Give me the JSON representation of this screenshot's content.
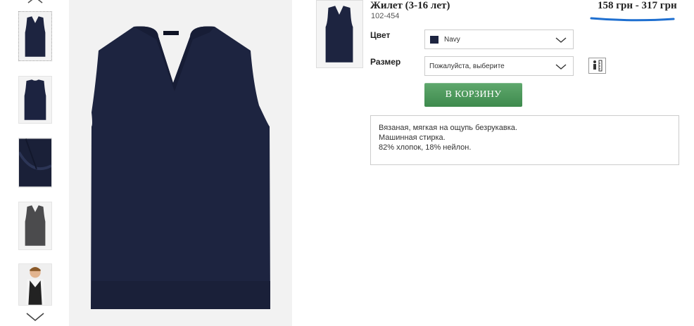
{
  "product": {
    "title": "Жилет (3-16 лет)",
    "code": "102-454",
    "price": "158 грн - 317 грн"
  },
  "options": {
    "color_label": "Цвет",
    "color_value": "Navy",
    "color_swatch": "#1d2440",
    "size_label": "Размер",
    "size_placeholder": "Пожалуйста, выберите"
  },
  "actions": {
    "add_to_cart": "В КОРЗИНУ",
    "cart_color": "#4a9a5a"
  },
  "description": [
    "Вязаная, мягкая на ощупь безрукавка.",
    "Машинная стирка.",
    "82% хлопок, 18% нейлон."
  ],
  "thumbnails": [
    {
      "name": "thumb-navy-front",
      "selected": true
    },
    {
      "name": "thumb-navy-back",
      "selected": false
    },
    {
      "name": "thumb-navy-detail",
      "selected": false
    },
    {
      "name": "thumb-grey-front",
      "selected": false
    },
    {
      "name": "thumb-model",
      "selected": false
    }
  ],
  "icons": {
    "scroll_up": "chevron-up-icon",
    "scroll_down": "chevron-down-icon",
    "select_arrow": "chevron-down-icon",
    "size_guide": "size-guide-icon"
  },
  "colors": {
    "navy": "#1d2440",
    "price_underline": "#1e6fd0"
  }
}
